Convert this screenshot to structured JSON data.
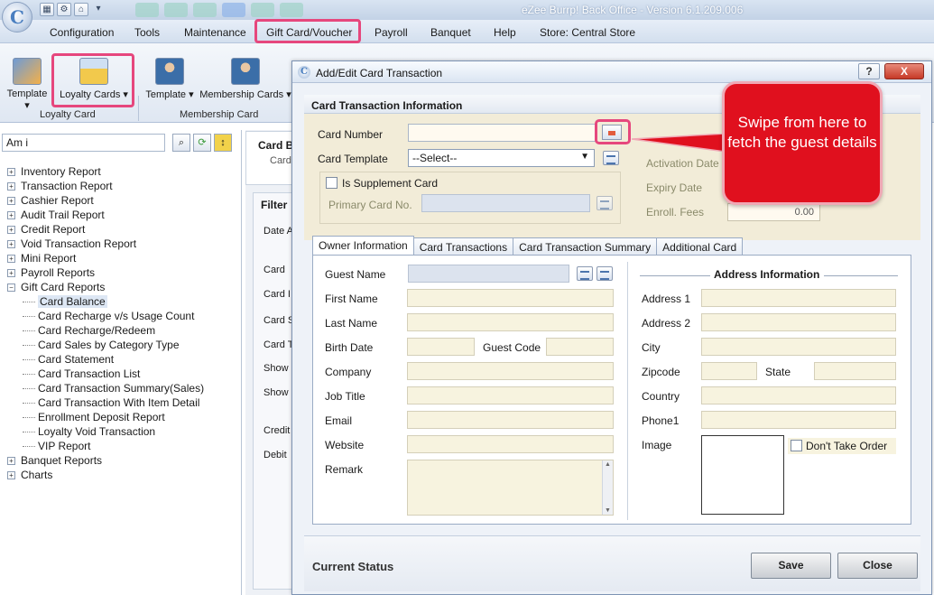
{
  "window": {
    "title": "eZee Burrp! Back Office - Version 6.1.209.006"
  },
  "menu": {
    "items": [
      "Configuration",
      "Tools",
      "Maintenance",
      "Gift Card/Voucher",
      "Payroll",
      "Banquet",
      "Help",
      "Store: Central Store"
    ]
  },
  "ribbon": {
    "loyalty_group": {
      "label": "Loyalty Card",
      "buttons": [
        "Template",
        "Loyalty Cards"
      ]
    },
    "membership_group": {
      "label": "Membership Card",
      "buttons": [
        "Template",
        "Membership Cards"
      ]
    }
  },
  "leftpanel": {
    "search_value": "Am i",
    "tree": [
      {
        "label": "Inventory Report",
        "level": 0,
        "sign": "+"
      },
      {
        "label": "Transaction Report",
        "level": 0,
        "sign": "+"
      },
      {
        "label": "Cashier Report",
        "level": 0,
        "sign": "+"
      },
      {
        "label": "Audit Trail Report",
        "level": 0,
        "sign": "+"
      },
      {
        "label": "Credit Report",
        "level": 0,
        "sign": "+"
      },
      {
        "label": "Void Transaction Report",
        "level": 0,
        "sign": "+"
      },
      {
        "label": "Mini Report",
        "level": 0,
        "sign": "+"
      },
      {
        "label": "Payroll Reports",
        "level": 0,
        "sign": "+"
      },
      {
        "label": "Gift Card Reports",
        "level": 0,
        "sign": "−"
      },
      {
        "label": "Card Balance",
        "level": 1,
        "selected": true
      },
      {
        "label": "Card Recharge v/s Usage Count",
        "level": 1
      },
      {
        "label": "Card Recharge/Redeem",
        "level": 1
      },
      {
        "label": "Card Sales by Category Type",
        "level": 1
      },
      {
        "label": "Card Statement",
        "level": 1
      },
      {
        "label": "Card Transaction List",
        "level": 1
      },
      {
        "label": "Card Transaction Summary(Sales)",
        "level": 1
      },
      {
        "label": "Card Transaction With Item Detail",
        "level": 1
      },
      {
        "label": "Enrollment Deposit Report",
        "level": 1
      },
      {
        "label": "Loyalty Void Transaction",
        "level": 1
      },
      {
        "label": "VIP Report",
        "level": 1
      },
      {
        "label": "Banquet Reports",
        "level": 0,
        "sign": "+"
      },
      {
        "label": "Charts",
        "level": 0,
        "sign": "+"
      }
    ]
  },
  "background_page": {
    "header_title": "Card B",
    "header_sub": "Card",
    "filter_title": "Filter",
    "labels": [
      "Date A",
      "Card",
      "Card I",
      "Card S",
      "Card T",
      "Show",
      "Show",
      "Credit",
      "Debit"
    ]
  },
  "dialog": {
    "title": "Add/Edit Card Transaction",
    "help_label": "?",
    "close_label": "X",
    "section_title": "Card Transaction Information",
    "card_number_label": "Card Number",
    "card_number_value": "",
    "card_template_label": "Card Template",
    "card_template_value": "--Select--",
    "is_supplement_label": "Is Supplement Card",
    "primary_card_label": "Primary Card No.",
    "activation_label": "Activation Date",
    "expiry_label": "Expiry Date",
    "enroll_fees_label": "Enroll. Fees",
    "enroll_fees_value": "0.00",
    "tabs": [
      "Owner Information",
      "Card Transactions",
      "Card Transaction Summary",
      "Additional Card"
    ],
    "owner": {
      "guest_name": "Guest Name",
      "first_name": "First Name",
      "last_name": "Last Name",
      "birth_date": "Birth Date",
      "guest_code": "Guest Code",
      "company": "Company",
      "job_title": "Job Title",
      "email": "Email",
      "website": "Website",
      "remark": "Remark"
    },
    "address": {
      "title": "Address Information",
      "address1": "Address 1",
      "address2": "Address 2",
      "city": "City",
      "zipcode": "Zipcode",
      "state": "State",
      "country": "Country",
      "phone1": "Phone1",
      "image": "Image",
      "dont_take_order": "Don't Take Order"
    },
    "current_status": "Current Status",
    "save_label": "Save",
    "close_button_label": "Close"
  },
  "callout": {
    "text": "Swipe from here to fetch the guest details"
  },
  "colors": {
    "highlight": "#e6477d",
    "callout": "#e0101e",
    "field_bg": "#f7f3df"
  }
}
